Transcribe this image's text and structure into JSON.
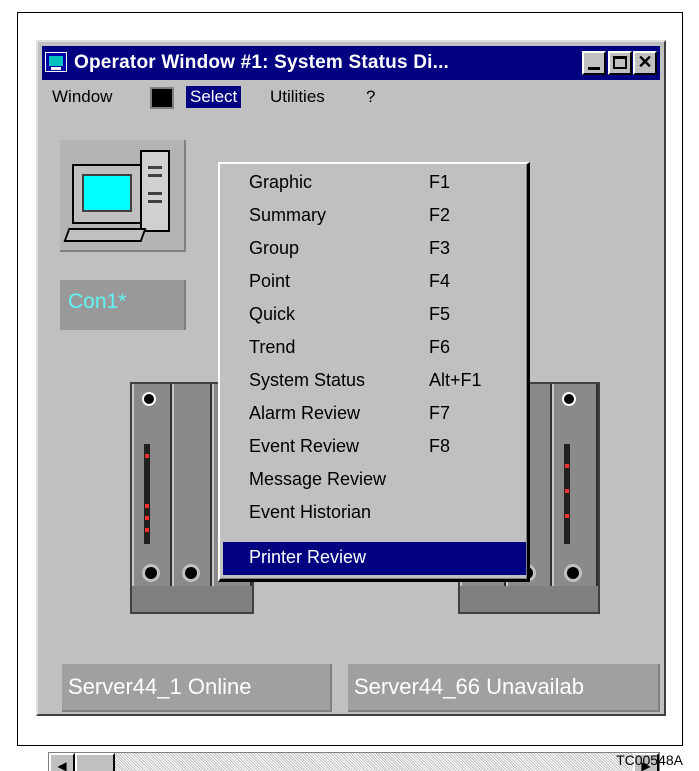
{
  "window": {
    "title": "Operator Window #1: System Status Di..."
  },
  "menubar": {
    "items": [
      "Window",
      "Select",
      "Utilities",
      "?"
    ]
  },
  "select_menu": {
    "items": [
      {
        "label": "Graphic",
        "shortcut": "F1"
      },
      {
        "label": "Summary",
        "shortcut": "F2"
      },
      {
        "label": "Group",
        "shortcut": "F3"
      },
      {
        "label": "Point",
        "shortcut": "F4"
      },
      {
        "label": "Quick",
        "shortcut": "F5"
      },
      {
        "label": "Trend",
        "shortcut": "F6"
      },
      {
        "label": "System Status",
        "shortcut": "Alt+F1"
      },
      {
        "label": "Alarm Review",
        "shortcut": "F7"
      },
      {
        "label": "Event Review",
        "shortcut": "F8"
      },
      {
        "label": "Message Review",
        "shortcut": ""
      },
      {
        "label": "Event Historian",
        "shortcut": ""
      },
      {
        "label": "Printer Review",
        "shortcut": ""
      }
    ],
    "selected": "Printer Review"
  },
  "nodes": {
    "console": "Con1*",
    "server_1": "Server44_1 Online",
    "server_66": "Server44_66 Unavailab"
  },
  "figure_code": "TC00548A",
  "colors": {
    "titlebar": "#000080",
    "highlight": "#000080",
    "console_text": "#5ff5f5"
  }
}
